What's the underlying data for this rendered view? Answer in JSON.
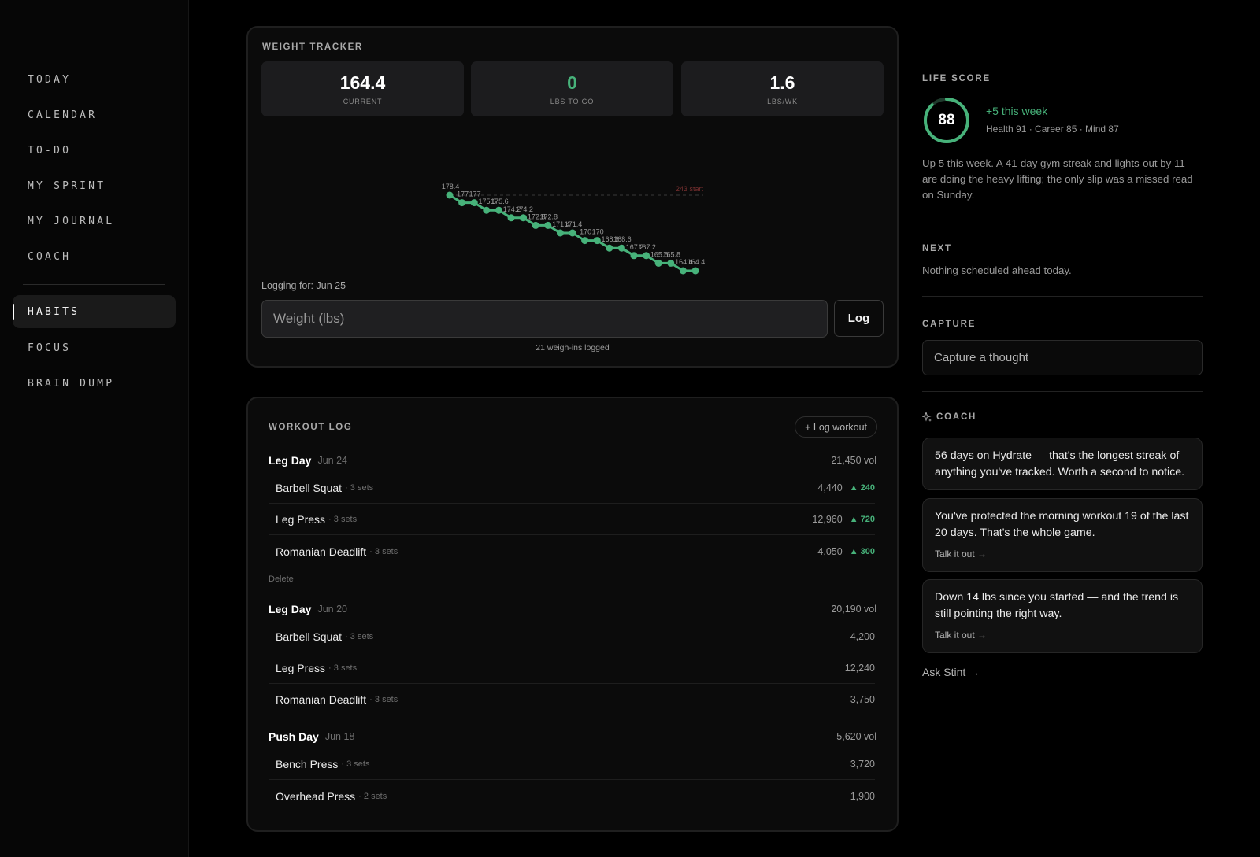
{
  "nav": {
    "items": [
      "TODAY",
      "CALENDAR",
      "TO-DO",
      "MY SPRINT",
      "MY JOURNAL",
      "COACH"
    ],
    "items2": [
      "HABITS",
      "FOCUS",
      "BRAIN DUMP"
    ],
    "active": "HABITS"
  },
  "weight": {
    "title": "WEIGHT TRACKER",
    "stats": [
      {
        "value": "164.4",
        "label": "CURRENT"
      },
      {
        "value": "0",
        "label": "LBS TO GO"
      },
      {
        "value": "1.6",
        "label": "LBS/WK"
      }
    ],
    "logging_for": "Logging for: Jun 25",
    "input_placeholder": "Weight (lbs)",
    "log_button": "Log",
    "weighins": "21 weigh-ins logged"
  },
  "chart_data": {
    "type": "line",
    "series": [
      {
        "values": [
          178.4,
          177,
          177,
          175.6,
          175.6,
          174.2,
          174.2,
          172.8,
          172.8,
          171.4,
          171.4,
          170,
          170,
          168.6,
          168.6,
          167.2,
          167.2,
          165.8,
          165.8,
          164.4,
          164.4
        ]
      }
    ],
    "data_labels": [
      "178.4",
      "177",
      "177",
      "175.6",
      "175.6",
      "174.2",
      "174.2",
      "172.8",
      "172.8",
      "171.4",
      "171.4",
      "170",
      "170",
      "168.6",
      "168.6",
      "167.2",
      "167.2",
      "165.8",
      "165.8",
      "164.4",
      "164.4"
    ],
    "reference_line": {
      "value": 178.4,
      "label": "243 start"
    },
    "ylim": [
      164.4,
      178.4
    ],
    "grid": false,
    "line_color": "#47b27a",
    "reference_color": "#7a3030"
  },
  "workout": {
    "title": "WORKOUT LOG",
    "add_button": "+ Log workout",
    "delete_label": "Delete",
    "sessions": [
      {
        "name": "Leg Day",
        "date": "Jun 24",
        "volume": "21,450 vol",
        "exercises": [
          {
            "name": "Barbell Squat",
            "sets": "· 3 sets",
            "volume": "4,440",
            "delta": "▲ 240"
          },
          {
            "name": "Leg Press",
            "sets": "· 3 sets",
            "volume": "12,960",
            "delta": "▲ 720"
          },
          {
            "name": "Romanian Deadlift",
            "sets": "· 3 sets",
            "volume": "4,050",
            "delta": "▲ 300"
          }
        ]
      },
      {
        "name": "Leg Day",
        "date": "Jun 20",
        "volume": "20,190 vol",
        "exercises": [
          {
            "name": "Barbell Squat",
            "sets": "· 3 sets",
            "volume": "4,200"
          },
          {
            "name": "Leg Press",
            "sets": "· 3 sets",
            "volume": "12,240"
          },
          {
            "name": "Romanian Deadlift",
            "sets": "· 3 sets",
            "volume": "3,750"
          }
        ]
      },
      {
        "name": "Push Day",
        "date": "Jun 18",
        "volume": "5,620 vol",
        "exercises": [
          {
            "name": "Bench Press",
            "sets": "· 3 sets",
            "volume": "3,720"
          },
          {
            "name": "Overhead Press",
            "sets": "· 2 sets",
            "volume": "1,900"
          }
        ]
      }
    ]
  },
  "life": {
    "label": "LIFE SCORE",
    "score": "88",
    "score_fraction": 0.88,
    "change": "+5 this week",
    "breakdown": "Health 91 · Career 85 · Mind 87",
    "summary": "Up 5 this week. A 41-day gym streak and lights-out by 11 are doing the heavy lifting; the only slip was a missed read on Sunday."
  },
  "next": {
    "label": "NEXT",
    "text": "Nothing scheduled ahead today."
  },
  "capture": {
    "label": "CAPTURE",
    "placeholder": "Capture a thought"
  },
  "coach": {
    "label": "COACH",
    "cards": [
      {
        "text": "56 days on Hydrate — that's the longest streak of anything you've tracked. Worth a second to notice."
      },
      {
        "text": "You've protected the morning workout 19 of the last 20 days. That's the whole game.",
        "link": "Talk it out →"
      },
      {
        "text": "Down 14 lbs since you started — and the trend is still pointing the right way.",
        "link": "Talk it out →"
      }
    ],
    "ask": "Ask Stint  →"
  }
}
